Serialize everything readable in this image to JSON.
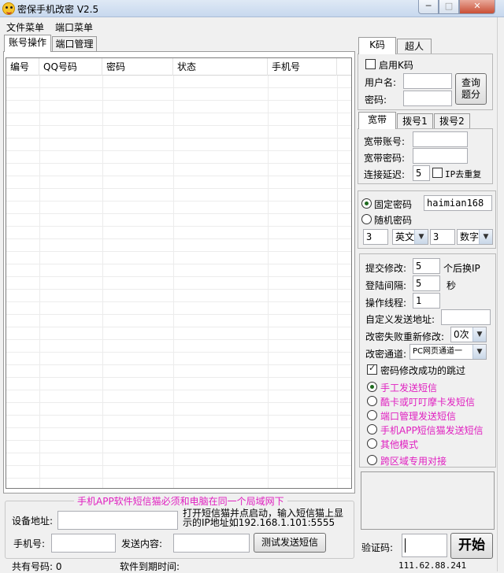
{
  "window": {
    "title": "密保手机改密 V2.5",
    "min_label": "─",
    "max_label": "□",
    "close_label": "✕"
  },
  "menu": {
    "items": [
      "文件菜单",
      "端口菜单"
    ]
  },
  "main_tabs": [
    "账号操作",
    "端口管理"
  ],
  "table": {
    "columns": [
      "编号",
      "QQ号码",
      "密码",
      "状态",
      "手机号"
    ],
    "rows": []
  },
  "k_panel": {
    "tabs": [
      "K码",
      "超人"
    ],
    "enable_label": "启用K码",
    "enable_checked": false,
    "username_label": "用户名:",
    "username_value": "",
    "password_label": "密码:",
    "password_value": "",
    "query_button": "查询\n题分"
  },
  "broadband_panel": {
    "tabs": [
      "宽带",
      "拨号1",
      "拨号2"
    ],
    "account_label": "宽带账号:",
    "account_value": "",
    "password_label": "宽带密码:",
    "password_value": "",
    "delay_label": "连接延迟:",
    "delay_value": "5",
    "ip_dedupe_label": "IP去重复",
    "ip_dedupe_checked": false
  },
  "password_panel": {
    "fixed_label": "固定密码",
    "fixed_selected": true,
    "fixed_value": "haimian168",
    "random_label": "随机密码",
    "random_selected": false,
    "count1": "3",
    "type1": "英文",
    "count2": "3",
    "type2": "数字"
  },
  "settings_panel": {
    "submit_label": "提交修改:",
    "submit_value": "5",
    "submit_suffix": "个后换IP",
    "login_interval_label": "登陆间隔:",
    "login_interval_value": "5",
    "login_interval_unit": "秒",
    "threads_label": "操作线程:",
    "threads_value": "1",
    "custom_addr_label": "自定义发送地址:",
    "custom_addr_value": "",
    "retry_label": "改密失败重新修改:",
    "retry_value": "0次",
    "channel_label": "改密通道:",
    "channel_value": "PC网页通道一",
    "skip_label": "密码修改成功的跳过",
    "skip_checked": true,
    "sms_options": [
      {
        "label": "手工发送短信",
        "selected": true
      },
      {
        "label": "酷卡或叮叮摩卡发短信",
        "selected": false
      },
      {
        "label": "端口管理发送短信",
        "selected": false
      },
      {
        "label": "手机APP短信猫发送短信",
        "selected": false
      },
      {
        "label": "其他模式",
        "selected": false
      },
      {
        "label": "跨区域专用对接",
        "selected": false
      }
    ]
  },
  "app_sms": {
    "legend": "手机APP软件短信猫必须和电脑在同一个局域网下",
    "device_label": "设备地址:",
    "device_value": "",
    "hint": "打开短信猫并点启动，输入短信猫上显示的IP地址如192.168.1.101:5555",
    "phone_label": "手机号:",
    "phone_value": "",
    "content_label": "发送内容:",
    "content_value": "",
    "test_button": "测试发送短信"
  },
  "captcha": {
    "label": "验证码:",
    "value": "",
    "start_button": "开始"
  },
  "status": {
    "total_label": "共有号码: 0",
    "expiry_label": "软件到期时间:",
    "ip": "111.62.88.241"
  },
  "colors": {
    "accent_magenta": "#e020c0",
    "close_red": "#c94f36"
  }
}
